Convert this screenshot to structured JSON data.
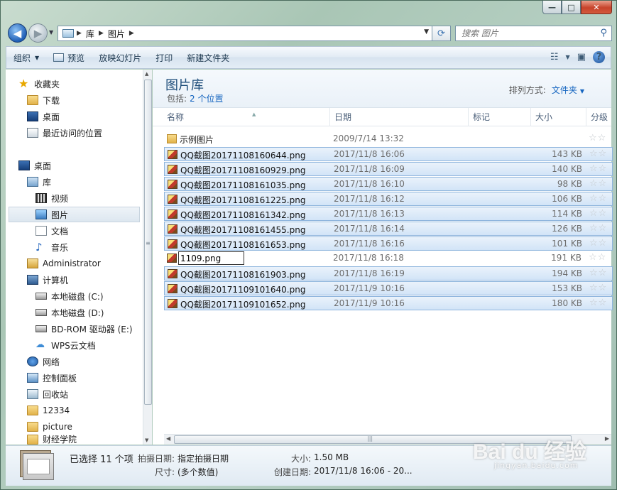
{
  "window": {
    "caption": {
      "minimize": "—",
      "maximize": "□",
      "close": "✕"
    }
  },
  "address": {
    "crumbs": [
      "库",
      "图片"
    ],
    "separator": "▶",
    "search_placeholder": "搜索 图片"
  },
  "toolbar": {
    "organize": "组织",
    "preview": "预览",
    "slideshow": "放映幻灯片",
    "print": "打印",
    "new_folder": "新建文件夹"
  },
  "nav": {
    "items": [
      {
        "label": "收藏夹",
        "icon": "star-icon"
      },
      {
        "label": "下载",
        "icon": "download-folder-icon"
      },
      {
        "label": "桌面",
        "icon": "desktop-icon"
      },
      {
        "label": "最近访问的位置",
        "icon": "recent-places-icon"
      },
      {
        "label": "桌面",
        "icon": "desktop-icon"
      },
      {
        "label": "库",
        "icon": "library-icon"
      },
      {
        "label": "视频",
        "icon": "video-icon"
      },
      {
        "label": "图片",
        "icon": "pictures-icon"
      },
      {
        "label": "文档",
        "icon": "documents-icon"
      },
      {
        "label": "音乐",
        "icon": "music-icon"
      },
      {
        "label": "Administrator",
        "icon": "user-folder-icon"
      },
      {
        "label": "计算机",
        "icon": "computer-icon"
      },
      {
        "label": "本地磁盘 (C:)",
        "icon": "drive-icon"
      },
      {
        "label": "本地磁盘 (D:)",
        "icon": "drive-icon"
      },
      {
        "label": "BD-ROM 驱动器 (E:)",
        "icon": "optical-drive-icon"
      },
      {
        "label": "WPS云文档",
        "icon": "cloud-icon"
      },
      {
        "label": "网络",
        "icon": "network-icon"
      },
      {
        "label": "控制面板",
        "icon": "control-panel-icon"
      },
      {
        "label": "回收站",
        "icon": "recycle-bin-icon"
      },
      {
        "label": "12334",
        "icon": "folder-icon"
      },
      {
        "label": "picture",
        "icon": "folder-icon"
      },
      {
        "label": "财经学院",
        "icon": "folder-icon"
      }
    ]
  },
  "library": {
    "title": "图片库",
    "includes_label": "包括:",
    "includes_link": "2 个位置",
    "arrange_label": "排列方式:",
    "arrange_value": "文件夹"
  },
  "columns": [
    "名称",
    "日期",
    "标记",
    "大小",
    "分级"
  ],
  "rename_value": "1109.png",
  "files": [
    {
      "name": "示例图片",
      "date": "2009/7/14 13:32",
      "size": "",
      "type": "folder",
      "selected": false
    },
    {
      "name": "QQ截图20171108160644.png",
      "date": "2017/11/8 16:06",
      "size": "143 KB",
      "type": "png",
      "selected": true
    },
    {
      "name": "QQ截图20171108160929.png",
      "date": "2017/11/8 16:09",
      "size": "140 KB",
      "type": "png",
      "selected": true
    },
    {
      "name": "QQ截图20171108161035.png",
      "date": "2017/11/8 16:10",
      "size": "98 KB",
      "type": "png",
      "selected": true
    },
    {
      "name": "QQ截图20171108161225.png",
      "date": "2017/11/8 16:12",
      "size": "106 KB",
      "type": "png",
      "selected": true
    },
    {
      "name": "QQ截图20171108161342.png",
      "date": "2017/11/8 16:13",
      "size": "114 KB",
      "type": "png",
      "selected": true
    },
    {
      "name": "QQ截图20171108161455.png",
      "date": "2017/11/8 16:14",
      "size": "126 KB",
      "type": "png",
      "selected": true
    },
    {
      "name": "QQ截图20171108161653.png",
      "date": "2017/11/8 16:16",
      "size": "101 KB",
      "type": "png",
      "selected": true
    },
    {
      "name": "",
      "date": "2017/11/8 16:18",
      "size": "191 KB",
      "type": "png",
      "selected": false,
      "renaming": true
    },
    {
      "name": "QQ截图20171108161903.png",
      "date": "2017/11/8 16:19",
      "size": "194 KB",
      "type": "png",
      "selected": true
    },
    {
      "name": "QQ截图20171109101640.png",
      "date": "2017/11/9 10:16",
      "size": "153 KB",
      "type": "png",
      "selected": true
    },
    {
      "name": "QQ截图20171109101652.png",
      "date": "2017/11/9 10:16",
      "size": "180 KB",
      "type": "png",
      "selected": true
    }
  ],
  "rating_stars": "☆☆",
  "details": {
    "selected_count": "已选择 11 个项",
    "taken_label": "拍摄日期:",
    "taken_value": "指定拍摄日期",
    "dims_label": "尺寸:",
    "dims_value": "(多个数值)",
    "size_label": "大小:",
    "size_value": "1.50 MB",
    "created_label": "创建日期:",
    "created_value": "2017/11/8 16:06 - 20..."
  },
  "watermark": {
    "logo": "Bai du 经验",
    "url": "jingyan.baidu.com"
  }
}
